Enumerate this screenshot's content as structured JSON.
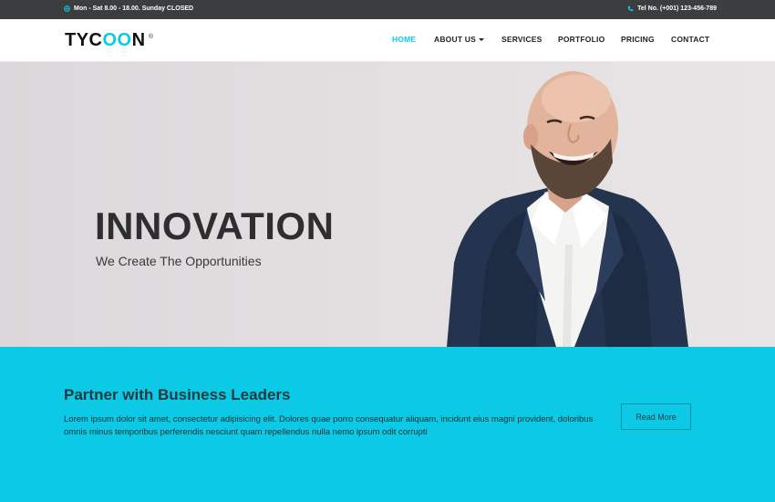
{
  "topbar": {
    "hours": "Mon - Sat 8.00 - 18.00. Sunday CLOSED",
    "phone": "Tel No. (+001) 123-456-789",
    "icons": [
      "globe-icon",
      "phone-icon"
    ]
  },
  "brand": {
    "logo_main": "TYC",
    "logo_accent": "OO",
    "logo_end": "N",
    "registered": "®",
    "accent_color": "#0ccae6"
  },
  "nav": {
    "items": [
      {
        "label": "HOME",
        "active": true
      },
      {
        "label": "ABOUT US",
        "dropdown": true
      },
      {
        "label": "SERVICES"
      },
      {
        "label": "PORTFOLIO"
      },
      {
        "label": "PRICING"
      },
      {
        "label": "CONTACT"
      }
    ]
  },
  "hero": {
    "title": "INNOVATION",
    "subtitle": "We Create The Opportunities"
  },
  "band": {
    "title": "Partner with Business Leaders",
    "text": "Lorem ipsum dolor sit amet, consectetur adipisicing elit. Dolores quae porro consequatur aliquam, incidunt eius magni provident, doloribus omnis minus temporibus perferendis nesciunt quam repellendus nulla nemo ipsum odit corrupti",
    "button": "Read More",
    "background_color": "#0ccae6"
  }
}
